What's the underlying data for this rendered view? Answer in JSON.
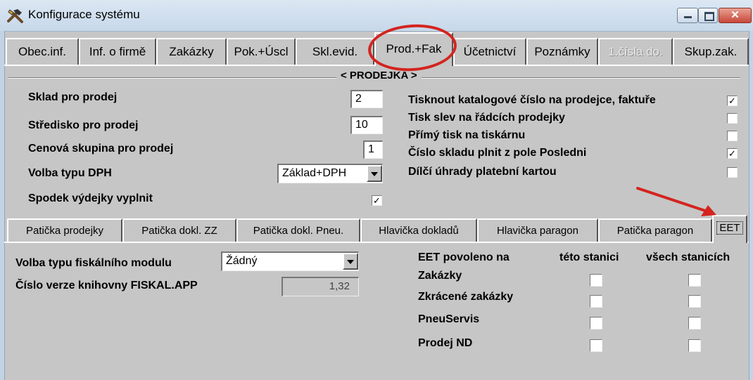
{
  "window": {
    "title": "Konfigurace systému",
    "close_symbol": "✕"
  },
  "top_tabs": [
    {
      "label": "Obec.inf."
    },
    {
      "label": "Inf. o firmě"
    },
    {
      "label": "Zakázky"
    },
    {
      "label": "Pok.+Úscl"
    },
    {
      "label": "Skl.evid."
    },
    {
      "label": "Prod.+Fak"
    },
    {
      "label": "Účetnictví"
    },
    {
      "label": "Poznámky"
    },
    {
      "label": "1.čísla do."
    },
    {
      "label": "Skup.zak."
    }
  ],
  "prodejka": {
    "group_title": "< PRODEJKA >",
    "sklad_label": "Sklad pro prodej",
    "sklad_value": "2",
    "stredisko_label": "Středisko pro prodej",
    "stredisko_value": "10",
    "cenova_label": "Cenová skupina pro prodej",
    "cenova_value": "1",
    "dph_label": "Volba typu DPH",
    "dph_value": "Základ+DPH",
    "spodek_label": "Spodek výdejky vyplnit",
    "spodek_check": "✓",
    "options": [
      {
        "label": "Tisknout katalogové číslo na prodejce, faktuře",
        "check": "✓"
      },
      {
        "label": "Tisk slev na řádcích prodejky",
        "check": ""
      },
      {
        "label": "Přímý tisk na tiskárnu",
        "check": ""
      },
      {
        "label": "Číslo skladu plnit z pole Posledni",
        "check": "✓"
      },
      {
        "label": "Dílčí úhrady platební kartou",
        "check": ""
      }
    ]
  },
  "bottom_tabs": [
    {
      "label": "Patička prodejky"
    },
    {
      "label": "Patička dokl. ZZ"
    },
    {
      "label": "Patička dokl. Pneu."
    },
    {
      "label": "Hlavička dokladů"
    },
    {
      "label": "Hlavička paragon"
    },
    {
      "label": "Patička paragon"
    },
    {
      "label": "EET"
    }
  ],
  "eet": {
    "fiskal_label": "Volba typu fiskálního modulu",
    "fiskal_value": "Žádný",
    "verze_label": "Číslo verze knihovny FISKAL.APP",
    "verze_value": "1,32",
    "povoleno_header": "EET povoleno na",
    "col_station": "této stanici",
    "col_all": "všech stanicích",
    "rows": [
      {
        "label": "Zakázky",
        "station": "",
        "all": ""
      },
      {
        "label": "Zkrácené zakázky",
        "station": "",
        "all": ""
      },
      {
        "label": "PneuServis",
        "station": "",
        "all": ""
      },
      {
        "label": "Prodej ND",
        "station": "",
        "all": ""
      }
    ]
  },
  "annotation_color": "#d4241f"
}
